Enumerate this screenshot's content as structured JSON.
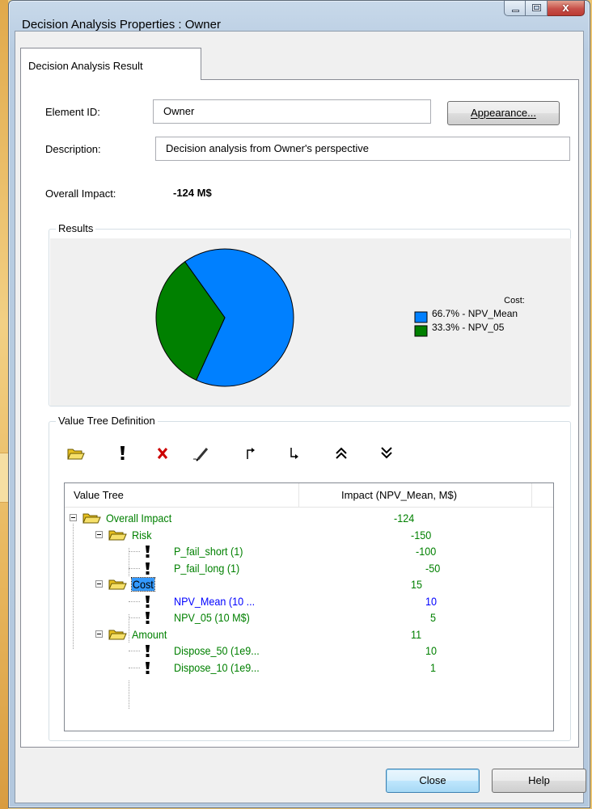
{
  "window": {
    "title": "Decision Analysis Properties : Owner",
    "close_glyph": "x"
  },
  "tab": {
    "label": "Decision Analysis Result"
  },
  "form": {
    "element_id_label": "Element ID:",
    "element_id_value": "Owner",
    "appearance_button": "Appearance...",
    "description_label": "Description:",
    "description_value": "Decision analysis from Owner's perspective",
    "overall_impact_label": "Overall Impact:",
    "overall_impact_value": "-124 M$"
  },
  "results": {
    "group_title": "Results",
    "chart_data": {
      "type": "pie",
      "legend_title": "Cost:",
      "legend_position": "right",
      "slices": [
        {
          "label": "66.7% - NPV_Mean",
          "value": 66.7,
          "color": "#0080ff"
        },
        {
          "label": "33.3% - NPV_05",
          "value": 33.3,
          "color": "#008000"
        }
      ]
    }
  },
  "value_tree": {
    "group_title": "Value Tree Definition",
    "toolbar": [
      {
        "name": "add-folder-icon"
      },
      {
        "name": "add-leaf-icon"
      },
      {
        "name": "delete-icon"
      },
      {
        "name": "edit-icon"
      },
      {
        "name": "move-up-icon"
      },
      {
        "name": "move-down-icon"
      },
      {
        "name": "expand-all-icon"
      },
      {
        "name": "collapse-all-icon"
      }
    ],
    "columns": [
      "Value Tree",
      "Impact (NPV_Mean, M$)"
    ],
    "rows": [
      {
        "name": "Overall Impact",
        "value": "-124",
        "color": "green"
      },
      {
        "name": "Risk",
        "value": "-150",
        "color": "green"
      },
      {
        "name": "P_fail_short (1)",
        "value": "-100",
        "color": "green"
      },
      {
        "name": "P_fail_long (1)",
        "value": "-50",
        "color": "green"
      },
      {
        "name": "Cost",
        "value": "15",
        "color": "green",
        "selected": true
      },
      {
        "name": "NPV_Mean (10 ...",
        "value": "10",
        "color": "blue"
      },
      {
        "name": "NPV_05 (10 M$)",
        "value": "5",
        "color": "green"
      },
      {
        "name": "Amount",
        "value": "11",
        "color": "green"
      },
      {
        "name": "Dispose_50 (1e9...",
        "value": "10",
        "color": "green"
      },
      {
        "name": "Dispose_10 (1e9...",
        "value": "1",
        "color": "green"
      }
    ]
  },
  "buttons": {
    "close": "Close",
    "help": "Help"
  }
}
